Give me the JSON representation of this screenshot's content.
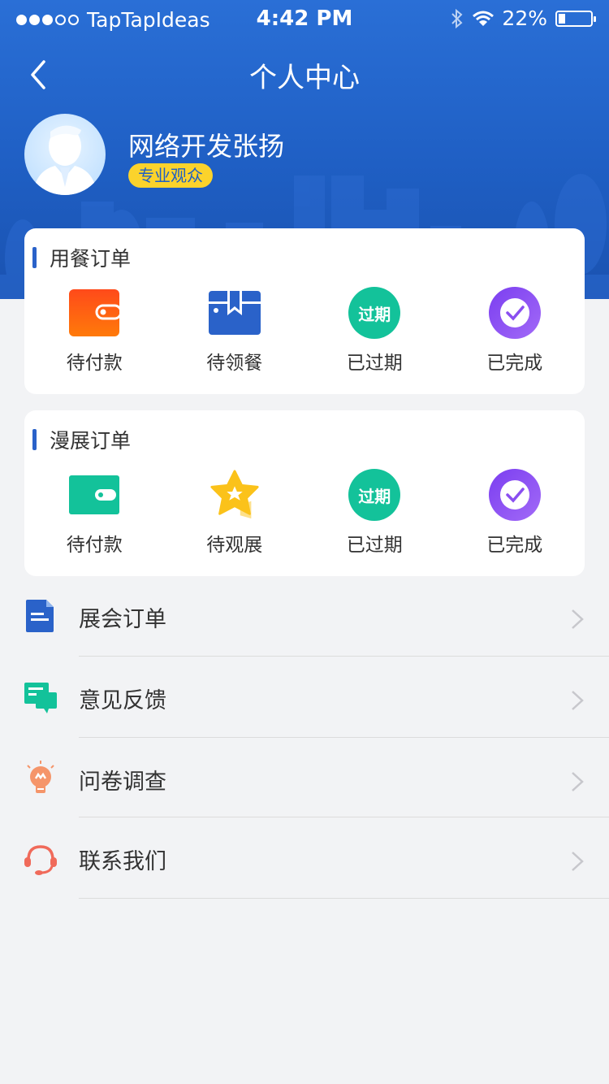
{
  "status_bar": {
    "carrier": "TapTapIdeas",
    "time": "4:42 PM",
    "battery": "22%",
    "battery_level": 0.22,
    "signal_bars_filled": 3,
    "signal_bars_total": 5
  },
  "nav": {
    "title": "个人中心",
    "back_icon": "chevron-left-icon"
  },
  "profile": {
    "name": "网络开发张扬",
    "badge": "专业观众"
  },
  "meal_orders": {
    "title": "用餐订单",
    "items": [
      {
        "label": "待付款",
        "icon": "wallet-icon",
        "color": "#ff5a1e"
      },
      {
        "label": "待领餐",
        "icon": "package-icon",
        "color": "#2a62c9"
      },
      {
        "label": "已过期",
        "icon": "expired-icon",
        "icon_text": "过期",
        "color": "#13c29a"
      },
      {
        "label": "已完成",
        "icon": "check-circle-icon",
        "color": "#8a4ff0"
      }
    ]
  },
  "comic_orders": {
    "title": "漫展订单",
    "items": [
      {
        "label": "待付款",
        "icon": "wallet-icon",
        "color": "#13c29a"
      },
      {
        "label": "待观展",
        "icon": "star-icon",
        "color": "#fbc21a"
      },
      {
        "label": "已过期",
        "icon": "expired-icon",
        "icon_text": "过期",
        "color": "#13c29a"
      },
      {
        "label": "已完成",
        "icon": "check-circle-icon",
        "color": "#8a4ff0"
      }
    ]
  },
  "menu": [
    {
      "label": "展会订单",
      "icon": "document-icon",
      "color": "#2a62c9"
    },
    {
      "label": "意见反馈",
      "icon": "feedback-icon",
      "color": "#13c29a"
    },
    {
      "label": "问卷调查",
      "icon": "lightbulb-icon",
      "color": "#f5956a"
    },
    {
      "label": "联系我们",
      "icon": "headset-icon",
      "color": "#f06a5a"
    }
  ],
  "colors": {
    "header": "#1f5fc4",
    "badge_bg": "#fbd32c",
    "accent": "#2a62c9"
  }
}
